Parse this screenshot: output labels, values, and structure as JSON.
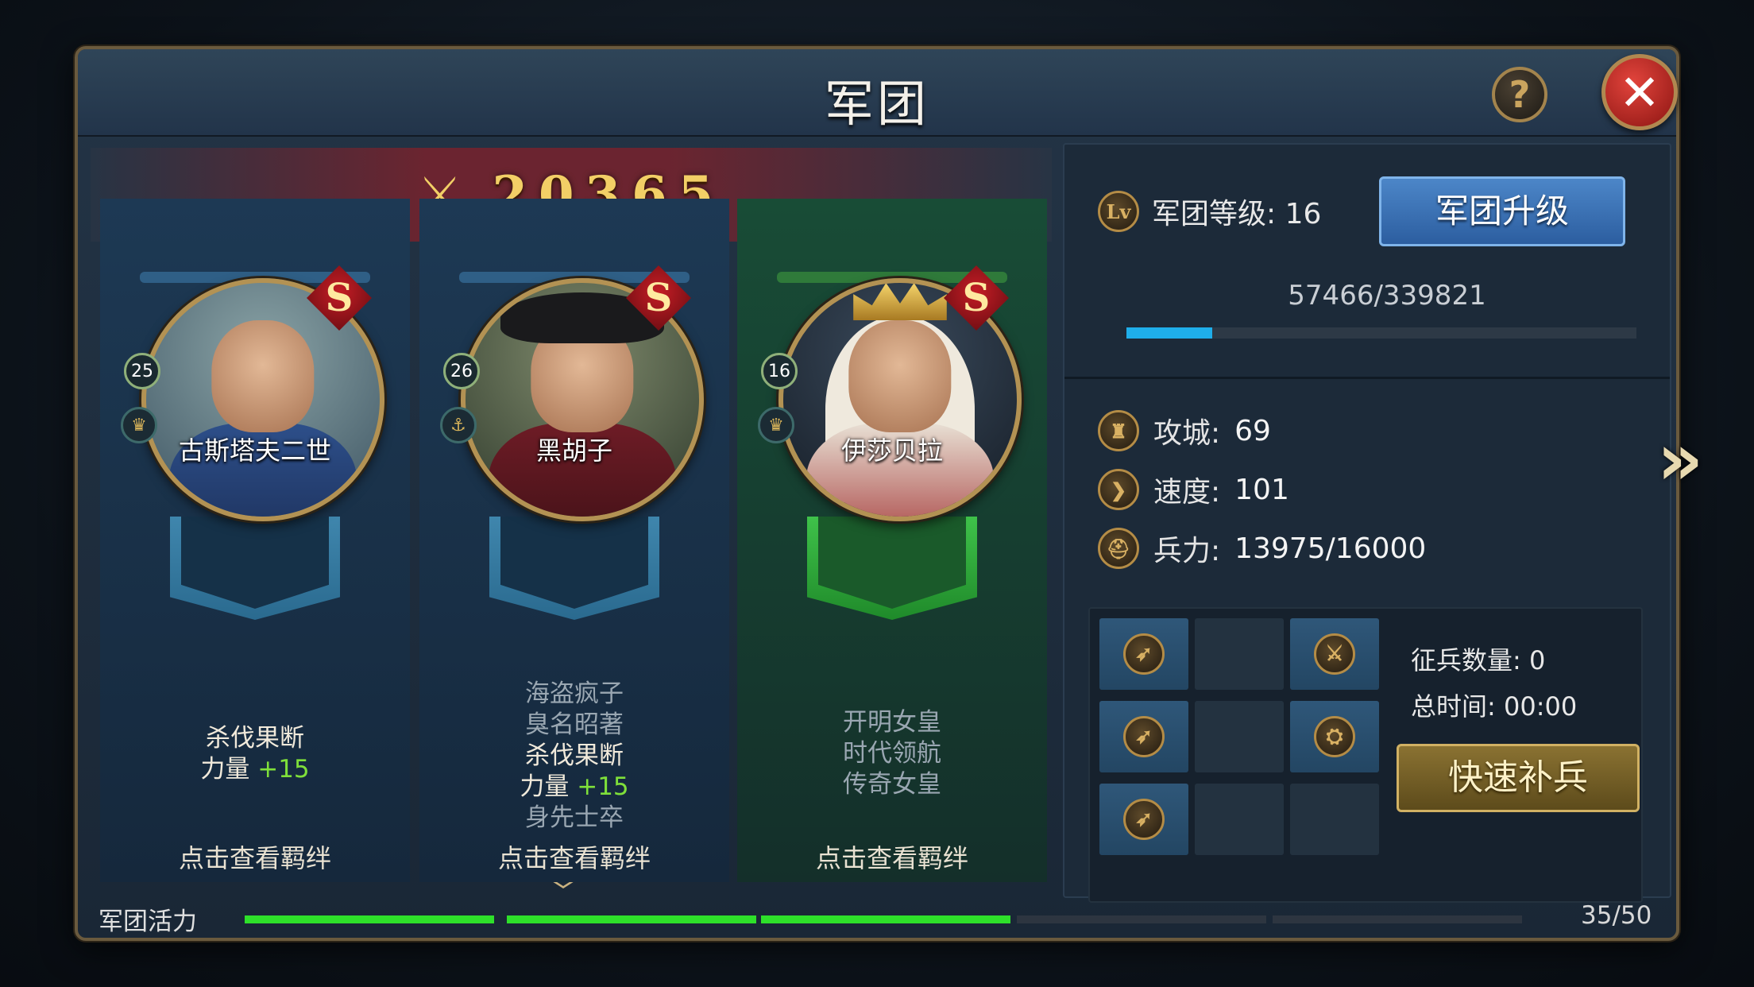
{
  "window": {
    "title": "军团"
  },
  "power": {
    "icon": "crossed-swords-icon",
    "value": "20365"
  },
  "heroes": [
    {
      "name": "古斯塔夫二世",
      "level": "25",
      "rank": "S",
      "badge_icon": "crown-icon",
      "skills": [
        {
          "text": "杀伐果断",
          "style": "bright"
        },
        {
          "text": "力量",
          "bonus": "+15",
          "style": "bright"
        }
      ],
      "bond_link": "点击查看羁绊"
    },
    {
      "name": "黑胡子",
      "level": "26",
      "rank": "S",
      "badge_icon": "anchor-icon",
      "skills": [
        {
          "text": "海盗疯子",
          "style": "muted"
        },
        {
          "text": "臭名昭著",
          "style": "muted"
        },
        {
          "text": "杀伐果断",
          "style": "bright"
        },
        {
          "text": "力量",
          "bonus": "+15",
          "style": "bright"
        },
        {
          "text": "身先士卒",
          "style": "muted"
        }
      ],
      "bond_link": "点击查看羁绊"
    },
    {
      "name": "伊莎贝拉",
      "level": "16",
      "rank": "S",
      "badge_icon": "crown-icon",
      "skills": [
        {
          "text": "开明女皇",
          "style": "muted"
        },
        {
          "text": "时代领航",
          "style": "muted"
        },
        {
          "text": "传奇女皇",
          "style": "muted"
        }
      ],
      "bond_link": "点击查看羁绊"
    }
  ],
  "legion": {
    "level_icon": "Lv",
    "level_label": "军团等级: 16",
    "upgrade_button": "军团升级",
    "exp_text": "57466/339821",
    "exp_fraction": 0.169
  },
  "stats": [
    {
      "icon": "siege-icon",
      "label": "攻城:",
      "value": "69"
    },
    {
      "icon": "speed-icon",
      "label": "速度:",
      "value": "101"
    },
    {
      "icon": "helmet-icon",
      "label": "兵力:",
      "value": "13975/16000"
    }
  ],
  "recruit": {
    "count_label": "征兵数量:",
    "count_value": "0",
    "time_label": "总时间:",
    "time_value": "00:00",
    "quick_button": "快速补兵",
    "slots": [
      {
        "filled": true,
        "icon": "bow-icon"
      },
      {
        "filled": false
      },
      {
        "filled": true,
        "icon": "sword-icon"
      },
      {
        "filled": true,
        "icon": "bow-icon"
      },
      {
        "filled": false
      },
      {
        "filled": true,
        "icon": "cannon-icon"
      },
      {
        "filled": true,
        "icon": "bow-icon"
      },
      {
        "filled": false
      },
      {
        "filled": false
      }
    ]
  },
  "activity": {
    "label": "军团活力",
    "value": "35/50",
    "current": 35,
    "max": 50,
    "segments_on": 3,
    "segments_total": 5
  },
  "help_icon": "?",
  "close_icon": "✕"
}
